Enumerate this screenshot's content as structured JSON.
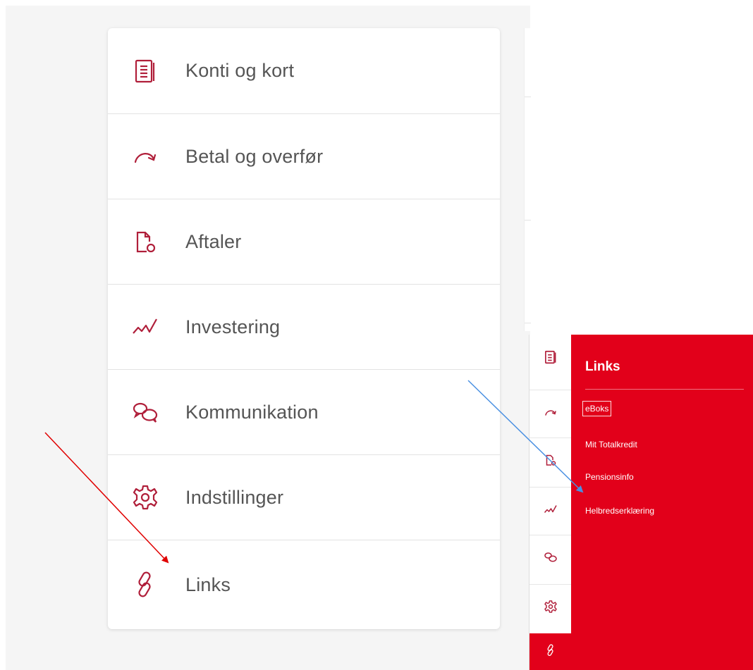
{
  "colors": {
    "accent": "#e2001a",
    "icon": "#b01f3a",
    "label": "#555555",
    "annotation_red_arrow": "#e00000",
    "annotation_blue_arrow": "#4a90e2"
  },
  "menu": {
    "items": [
      {
        "label": "Konti og kort",
        "icon": "accounts-document-icon"
      },
      {
        "label": "Betal og overfør",
        "icon": "transfer-arrow-icon"
      },
      {
        "label": "Aftaler",
        "icon": "agreement-document-icon"
      },
      {
        "label": "Investering",
        "icon": "investment-chart-icon"
      },
      {
        "label": "Kommunikation",
        "icon": "chat-bubbles-icon"
      },
      {
        "label": "Indstillinger",
        "icon": "gear-icon"
      },
      {
        "label": "Links",
        "icon": "link-icon"
      }
    ]
  },
  "collapsed_menu": {
    "icons": [
      "accounts-document-icon",
      "transfer-arrow-icon",
      "agreement-document-icon",
      "investment-chart-icon",
      "chat-bubbles-icon",
      "gear-icon",
      "link-icon"
    ],
    "active_index": 6
  },
  "links_panel": {
    "title": "Links",
    "items": [
      {
        "label": "eBoks",
        "focused": true
      },
      {
        "label": "Mit Totalkredit",
        "focused": false
      },
      {
        "label": "Pensionsinfo",
        "focused": false
      },
      {
        "label": "Helbredserklæring",
        "focused": false
      }
    ]
  }
}
